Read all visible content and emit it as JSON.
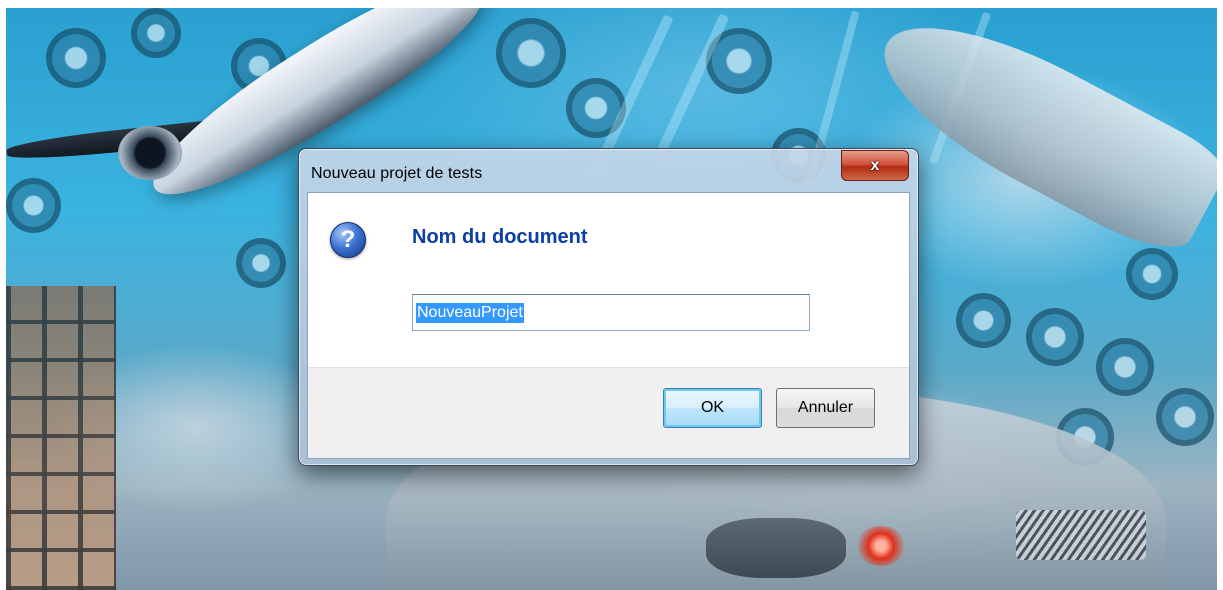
{
  "dialog": {
    "title": "Nouveau projet de tests",
    "close_label": "x",
    "icon": "question-icon",
    "heading": "Nom du document",
    "input_value": "NouveauProjet",
    "ok_label": "OK",
    "cancel_label": "Annuler"
  },
  "colors": {
    "heading": "#0a3fa3",
    "selection": "#3399ff",
    "close_button": "#c7381a"
  }
}
